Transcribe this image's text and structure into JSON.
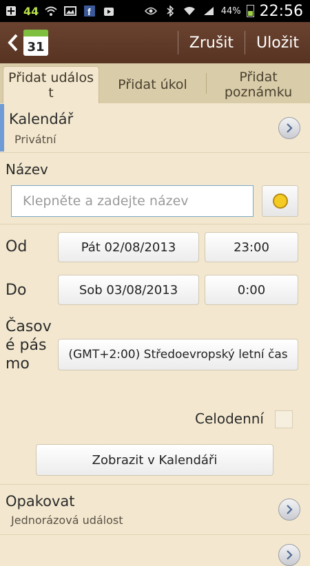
{
  "status_bar": {
    "badge": "44",
    "battery": "44%",
    "time": "22:56"
  },
  "header": {
    "calendar_day": "31",
    "cancel": "Zrušit",
    "save": "Uložit"
  },
  "tabs": [
    {
      "label": "Přidat událost",
      "active": true
    },
    {
      "label": "Přidat úkol",
      "active": false
    },
    {
      "label": "Přidat poznámku",
      "active": false
    }
  ],
  "calendar": {
    "title": "Kalendář",
    "value": "Privátní"
  },
  "name": {
    "label": "Název",
    "placeholder": "Klepněte a zadejte název"
  },
  "from": {
    "label": "Od",
    "date": "Pát 02/08/2013",
    "time": "23:00"
  },
  "to": {
    "label": "Do",
    "date": "Sob 03/08/2013",
    "time": "0:00"
  },
  "timezone": {
    "label": "Časové pásmo",
    "value": "(GMT+2:00) Středoevropský letní čas"
  },
  "all_day": {
    "label": "Celodenní"
  },
  "show_in_calendar": "Zobrazit v Kalendáři",
  "repeat": {
    "title": "Opakovat",
    "value": "Jednorázová událost"
  },
  "colors": {
    "header": "#5f3a27",
    "background": "#f3e8cf",
    "accent": "#6f9bd6"
  }
}
